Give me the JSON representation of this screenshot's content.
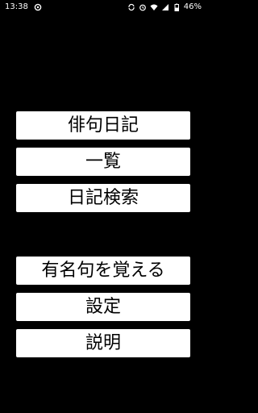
{
  "status_bar": {
    "time": "13:38",
    "battery": "46%",
    "icons": [
      "notification-icon",
      "sync-icon",
      "alarm-icon",
      "wifi-icon",
      "signal-icon",
      "battery-icon"
    ]
  },
  "menu": {
    "haiku_diary": "俳句日記",
    "list": "一覧",
    "diary_search": "日記検索",
    "memorize_famous": "有名句を覚える",
    "settings": "設定",
    "help": "説明"
  },
  "colors": {
    "background": "#000000",
    "button_bg": "#ffffff",
    "button_text": "#000000"
  }
}
